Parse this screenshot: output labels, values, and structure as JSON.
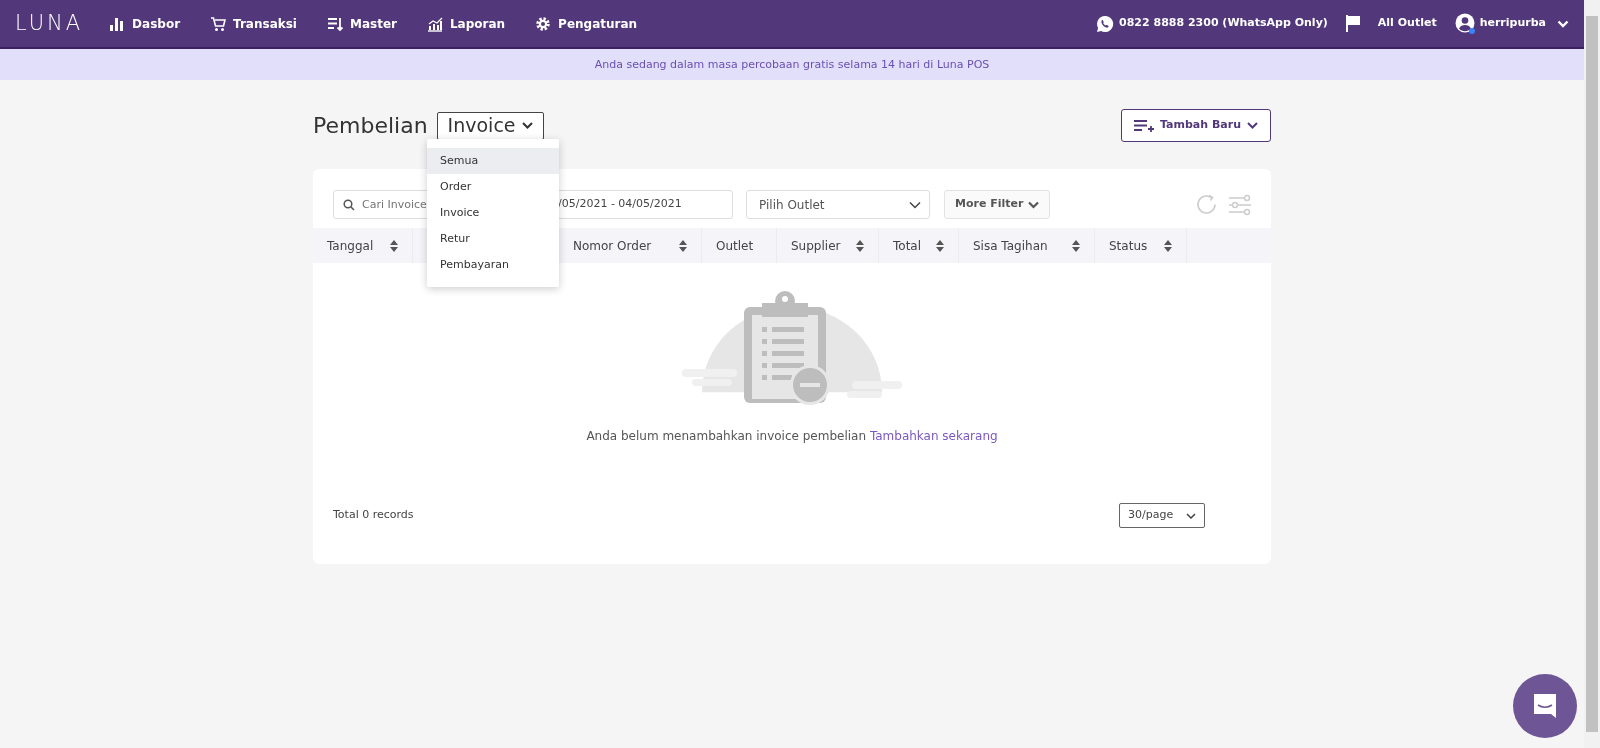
{
  "navbar": {
    "logo": "LUNA",
    "items": [
      {
        "label": "Dasbor"
      },
      {
        "label": "Transaksi"
      },
      {
        "label": "Master"
      },
      {
        "label": "Laporan"
      },
      {
        "label": "Pengaturan"
      }
    ],
    "phone": "0822 8888 2300 (WhatsApp Only)",
    "outlet": "All Outlet",
    "user": "herripurba"
  },
  "banner": "Anda sedang dalam masa percobaan gratis selama 14 hari di Luna POS",
  "page": {
    "title": "Pembelian",
    "type_button": "Invoice",
    "add_button": "Tambah Baru"
  },
  "type_menu": [
    {
      "label": "Semua",
      "selected": true
    },
    {
      "label": "Order",
      "selected": false
    },
    {
      "label": "Invoice",
      "selected": false
    },
    {
      "label": "Retur",
      "selected": false
    },
    {
      "label": "Pembayaran",
      "selected": false
    }
  ],
  "filters": {
    "search": {
      "placeholder": "Cari Invoice"
    },
    "date_range": {
      "value": "/05/2021 - 04/05/2021"
    },
    "outlet": {
      "placeholder": "Pilih Outlet"
    },
    "more_filter": "More Filter"
  },
  "table": {
    "columns": [
      {
        "label": "Tanggal",
        "sortable": true
      },
      {
        "label": "Nomor Order",
        "sortable": true
      },
      {
        "label": "Outlet",
        "sortable": false
      },
      {
        "label": "Supplier",
        "sortable": true
      },
      {
        "label": "Total",
        "sortable": true
      },
      {
        "label": "Sisa Tagihan",
        "sortable": true
      },
      {
        "label": "Status",
        "sortable": true
      }
    ],
    "empty_message": "Anda belum menambahkan invoice pembelian",
    "empty_link": "Tambahkan sekarang"
  },
  "footer": {
    "total": "Total 0 records",
    "page_size": "30/page"
  }
}
